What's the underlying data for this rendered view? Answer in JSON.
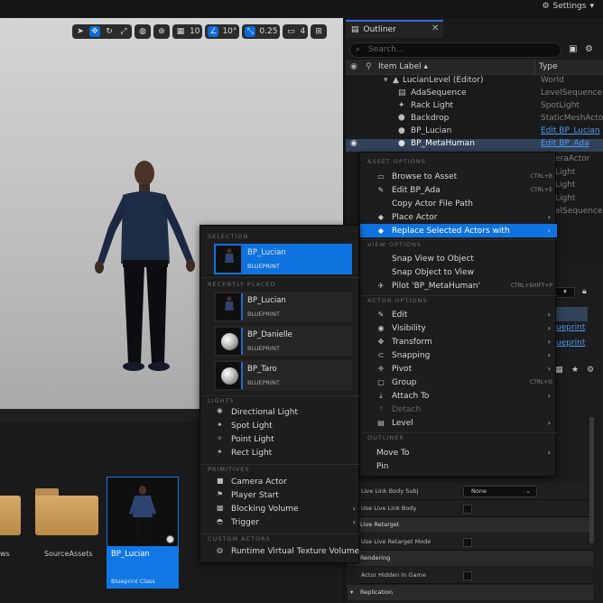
{
  "topbar": {
    "settings_label": "Settings"
  },
  "viewport": {
    "toolbar": {
      "grid_snap": "10",
      "angle_snap": "10°",
      "scale_snap": "0.25",
      "camera_speed": "4"
    }
  },
  "content_browser": {
    "folders": [
      {
        "label": "ws"
      },
      {
        "label": "SourceAssets"
      }
    ],
    "selected_asset": {
      "name": "BP_Lucian",
      "class": "Blueprint Class"
    }
  },
  "outliner": {
    "tab_label": "Outliner",
    "search_placeholder": "Search...",
    "col_item_label": "Item Label ▴",
    "col_type": "Type",
    "rows": [
      {
        "label": "LucianLevel (Editor)",
        "type": "World"
      },
      {
        "label": "AdaSequence",
        "type": "LevelSequence"
      },
      {
        "label": "Rack Light",
        "type": "SpotLight"
      },
      {
        "label": "Backdrop",
        "type": "StaticMeshActor"
      },
      {
        "label": "BP_Lucian",
        "type": "Edit BP_Lucian"
      },
      {
        "label": "BP_MetaHuman",
        "type": "Edit BP_Ada"
      }
    ],
    "partial_types": [
      "eraActor",
      "Light",
      "Light",
      "Light",
      "elSequence"
    ]
  },
  "context_menu": {
    "sections": {
      "asset": "ASSET OPTIONS",
      "view": "VIEW OPTIONS",
      "actor": "ACTOR OPTIONS",
      "outliner": "OUTLINER"
    },
    "items": [
      {
        "label": "Browse to Asset",
        "shortcut": "CTRL+B"
      },
      {
        "label": "Edit BP_Ada",
        "shortcut": "CTRL+E"
      },
      {
        "label": "Copy Actor File Path"
      },
      {
        "label": "Place Actor"
      },
      {
        "label": "Replace Selected Actors with"
      },
      {
        "label": "Snap View to Object"
      },
      {
        "label": "Snap Object to View"
      },
      {
        "label": "Pilot 'BP_MetaHuman'",
        "shortcut": "CTRL+SHIFT+P"
      },
      {
        "label": "Edit"
      },
      {
        "label": "Visibility"
      },
      {
        "label": "Transform"
      },
      {
        "label": "Snapping"
      },
      {
        "label": "Pivot"
      },
      {
        "label": "Group",
        "shortcut": "CTRL+G"
      },
      {
        "label": "Attach To"
      },
      {
        "label": "Detach"
      },
      {
        "label": "Level"
      },
      {
        "label": "Move To"
      },
      {
        "label": "Pin"
      }
    ]
  },
  "submenu": {
    "sections": {
      "selection": "SELECTION",
      "recent": "RECENTLY PLACED",
      "lights": "LIGHTS",
      "primitives": "PRIMITIVES",
      "custom": "CUSTOM ACTORS"
    },
    "selection_card": {
      "name": "BP_Lucian",
      "type": "BLUEPRINT"
    },
    "recent_cards": [
      {
        "name": "BP_Lucian",
        "type": "BLUEPRINT"
      },
      {
        "name": "BP_Danielle",
        "type": "BLUEPRINT"
      },
      {
        "name": "BP_Taro",
        "type": "BLUEPRINT"
      }
    ],
    "lights": [
      "Directional Light",
      "Spot Light",
      "Point Light",
      "Rect Light"
    ],
    "primitives": [
      "Camera Actor",
      "Player Start",
      "Blocking Volume",
      "Trigger"
    ],
    "custom": [
      "Runtime Virtual Texture Volume"
    ]
  },
  "details": {
    "partial_texts": [
      "ueprint",
      "ueprint"
    ],
    "rows": [
      {
        "label": "Live Link Body Subj",
        "value": "None"
      },
      {
        "label": "Use Live Link Body"
      },
      {
        "section": "Live Retarget"
      },
      {
        "label": "Use Live Retarget Mode"
      },
      {
        "section": "Rendering"
      },
      {
        "label": "Actor Hidden In Game"
      },
      {
        "section": "Replication"
      }
    ]
  },
  "colors": {
    "accent": "#0f73df",
    "selection_row": "#324259",
    "folder": "#c99a56"
  }
}
